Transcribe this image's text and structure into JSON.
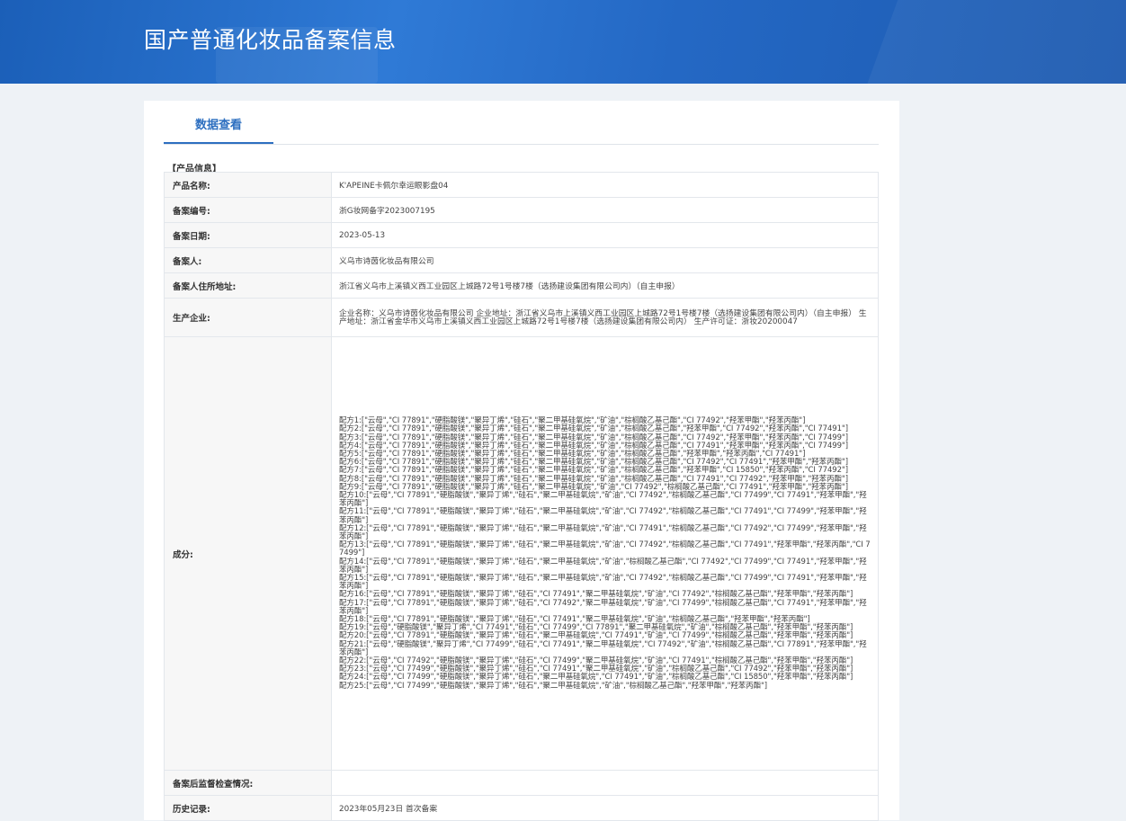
{
  "header": {
    "title": "国产普通化妆品备案信息"
  },
  "tabs": [
    {
      "label": "数据查看"
    }
  ],
  "section": {
    "label": "【产品信息】"
  },
  "rows": {
    "product_name": {
      "label": "产品名称:",
      "value": "K'APEINE卡佩尔幸运眼影盘04"
    },
    "record_no": {
      "label": "备案编号:",
      "value": "浙G妆网备字2023007195"
    },
    "record_date": {
      "label": "备案日期:",
      "value": "2023-05-13"
    },
    "registrant": {
      "label": "备案人:",
      "value": "义乌市诗茵化妆品有限公司"
    },
    "registrant_address": {
      "label": "备案人住所地址:",
      "value": "浙江省义乌市上溪镇义西工业园区上城路72号1号楼7楼（选扬建设集团有限公司内）（自主申报）"
    },
    "manufacturer": {
      "label": "生产企业:",
      "value": "企业名称：义乌市诗茵化妆品有限公司 企业地址：浙江省义乌市上溪镇义西工业园区上城路72号1号楼7楼（选扬建设集团有限公司内）（自主申报） 生产地址：浙江省金华市义乌市上溪镇义西工业园区上城路72号1号楼7楼（选扬建设集团有限公司内） 生产许可证：浙妆20200047"
    },
    "ingredients": {
      "label": "成分:"
    },
    "post_supervision": {
      "label": "备案后监督检查情况:",
      "value": ""
    },
    "history": {
      "label": "历史记录:",
      "value": "2023年05月23日 首次备案"
    }
  },
  "formulas": [
    "配方1:[\"云母\",\"CI 77891\",\"硬脂酸镁\",\"聚异丁烯\",\"硅石\",\"聚二甲基硅氧烷\",\"矿油\",\"棕榈酸乙基己酯\",\"CI 77492\",\"羟苯甲酯\",\"羟苯丙酯\"]",
    "配方2:[\"云母\",\"CI 77891\",\"硬脂酸镁\",\"聚异丁烯\",\"硅石\",\"聚二甲基硅氧烷\",\"矿油\",\"棕榈酸乙基己酯\",\"羟苯甲酯\",\"CI 77492\",\"羟苯丙酯\",\"CI 77491\"]",
    "配方3:[\"云母\",\"CI 77891\",\"硬脂酸镁\",\"聚异丁烯\",\"硅石\",\"聚二甲基硅氧烷\",\"矿油\",\"棕榈酸乙基己酯\",\"CI 77492\",\"羟苯甲酯\",\"羟苯丙酯\",\"CI 77499\"]",
    "配方4:[\"云母\",\"CI 77891\",\"硬脂酸镁\",\"聚异丁烯\",\"硅石\",\"聚二甲基硅氧烷\",\"矿油\",\"棕榈酸乙基己酯\",\"CI 77491\",\"羟苯甲酯\",\"羟苯丙酯\",\"CI 77499\"]",
    "配方5:[\"云母\",\"CI 77891\",\"硬脂酸镁\",\"聚异丁烯\",\"硅石\",\"聚二甲基硅氧烷\",\"矿油\",\"棕榈酸乙基己酯\",\"羟苯甲酯\",\"羟苯丙酯\",\"CI 77491\"]",
    "配方6:[\"云母\",\"CI 77891\",\"硬脂酸镁\",\"聚异丁烯\",\"硅石\",\"聚二甲基硅氧烷\",\"矿油\",\"棕榈酸乙基己酯\",\"CI 77492\",\"CI 77491\",\"羟苯甲酯\",\"羟苯丙酯\"]",
    "配方7:[\"云母\",\"CI 77891\",\"硬脂酸镁\",\"聚异丁烯\",\"硅石\",\"聚二甲基硅氧烷\",\"矿油\",\"棕榈酸乙基己酯\",\"羟苯甲酯\",\"CI 15850\",\"羟苯丙酯\",\"CI 77492\"]",
    "配方8:[\"云母\",\"CI 77891\",\"硬脂酸镁\",\"聚异丁烯\",\"硅石\",\"聚二甲基硅氧烷\",\"矿油\",\"棕榈酸乙基己酯\",\"CI 77491\",\"CI 77492\",\"羟苯甲酯\",\"羟苯丙酯\"]",
    "配方9:[\"云母\",\"CI 77891\",\"硬脂酸镁\",\"聚异丁烯\",\"硅石\",\"聚二甲基硅氧烷\",\"矿油\",\"CI 77492\",\"棕榈酸乙基己酯\",\"CI 77491\",\"羟苯甲酯\",\"羟苯丙酯\"]",
    "配方10:[\"云母\",\"CI 77891\",\"硬脂酸镁\",\"聚异丁烯\",\"硅石\",\"聚二甲基硅氧烷\",\"矿油\",\"CI 77492\",\"棕榈酸乙基己酯\",\"CI 77499\",\"CI 77491\",\"羟苯甲酯\",\"羟苯丙酯\"]",
    "配方11:[\"云母\",\"CI 77891\",\"硬脂酸镁\",\"聚异丁烯\",\"硅石\",\"聚二甲基硅氧烷\",\"矿油\",\"CI 77492\",\"棕榈酸乙基己酯\",\"CI 77491\",\"CI 77499\",\"羟苯甲酯\",\"羟苯丙酯\"]",
    "配方12:[\"云母\",\"CI 77891\",\"硬脂酸镁\",\"聚异丁烯\",\"硅石\",\"聚二甲基硅氧烷\",\"矿油\",\"CI 77491\",\"棕榈酸乙基己酯\",\"CI 77492\",\"CI 77499\",\"羟苯甲酯\",\"羟苯丙酯\"]",
    "配方13:[\"云母\",\"CI 77891\",\"硬脂酸镁\",\"聚异丁烯\",\"硅石\",\"聚二甲基硅氧烷\",\"矿油\",\"CI 77492\",\"棕榈酸乙基己酯\",\"CI 77491\",\"羟苯甲酯\",\"羟苯丙酯\",\"CI 77499\"]",
    "配方14:[\"云母\",\"CI 77891\",\"硬脂酸镁\",\"聚异丁烯\",\"硅石\",\"聚二甲基硅氧烷\",\"矿油\",\"棕榈酸乙基己酯\",\"CI 77492\",\"CI 77499\",\"CI 77491\",\"羟苯甲酯\",\"羟苯丙酯\"]",
    "配方15:[\"云母\",\"CI 77891\",\"硬脂酸镁\",\"聚异丁烯\",\"硅石\",\"聚二甲基硅氧烷\",\"矿油\",\"CI 77492\",\"棕榈酸乙基己酯\",\"CI 77499\",\"CI 77491\",\"羟苯甲酯\",\"羟苯丙酯\"]",
    "配方16:[\"云母\",\"CI 77891\",\"硬脂酸镁\",\"聚异丁烯\",\"硅石\",\"CI 77491\",\"聚二甲基硅氧烷\",\"矿油\",\"CI 77492\",\"棕榈酸乙基己酯\",\"羟苯甲酯\",\"羟苯丙酯\"]",
    "配方17:[\"云母\",\"CI 77891\",\"硬脂酸镁\",\"聚异丁烯\",\"硅石\",\"CI 77492\",\"聚二甲基硅氧烷\",\"矿油\",\"CI 77499\",\"棕榈酸乙基己酯\",\"CI 77491\",\"羟苯甲酯\",\"羟苯丙酯\"]",
    "配方18:[\"云母\",\"CI 77891\",\"硬脂酸镁\",\"聚异丁烯\",\"硅石\",\"CI 77491\",\"聚二甲基硅氧烷\",\"矿油\",\"棕榈酸乙基己酯\",\"羟苯甲酯\",\"羟苯丙酯\"]",
    "配方19:[\"云母\",\"硬脂酸镁\",\"聚异丁烯\",\"CI 77491\",\"硅石\",\"CI 77499\",\"CI 77891\",\"聚二甲基硅氧烷\",\"矿油\",\"棕榈酸乙基己酯\",\"羟苯甲酯\",\"羟苯丙酯\"]",
    "配方20:[\"云母\",\"CI 77891\",\"硬脂酸镁\",\"聚异丁烯\",\"硅石\",\"聚二甲基硅氧烷\",\"CI 77491\",\"矿油\",\"CI 77499\",\"棕榈酸乙基己酯\",\"羟苯甲酯\",\"羟苯丙酯\"]",
    "配方21:[\"云母\",\"硬脂酸镁\",\"聚异丁烯\",\"CI 77499\",\"硅石\",\"CI 77491\",\"聚二甲基硅氧烷\",\"CI 77492\",\"矿油\",\"棕榈酸乙基己酯\",\"CI 77891\",\"羟苯甲酯\",\"羟苯丙酯\"]",
    "配方22:[\"云母\",\"CI 77492\",\"硬脂酸镁\",\"聚异丁烯\",\"硅石\",\"CI 77499\",\"聚二甲基硅氧烷\",\"矿油\",\"CI 77491\",\"棕榈酸乙基己酯\",\"羟苯甲酯\",\"羟苯丙酯\"]",
    "配方23:[\"云母\",\"CI 77499\",\"硬脂酸镁\",\"聚异丁烯\",\"硅石\",\"CI 77491\",\"聚二甲基硅氧烷\",\"矿油\",\"棕榈酸乙基己酯\",\"CI 77492\",\"羟苯甲酯\",\"羟苯丙酯\"]",
    "配方24:[\"云母\",\"CI 77499\",\"硬脂酸镁\",\"聚异丁烯\",\"硅石\",\"聚二甲基硅氧烷\",\"CI 77491\",\"矿油\",\"棕榈酸乙基己酯\",\"CI 15850\",\"羟苯甲酯\",\"羟苯丙酯\"]",
    "配方25:[\"云母\",\"CI 77499\",\"硬脂酸镁\",\"聚异丁烯\",\"硅石\",\"聚二甲基硅氧烷\",\"矿油\",\"棕榈酸乙基己酯\",\"羟苯甲酯\",\"羟苯丙酯\"]"
  ]
}
